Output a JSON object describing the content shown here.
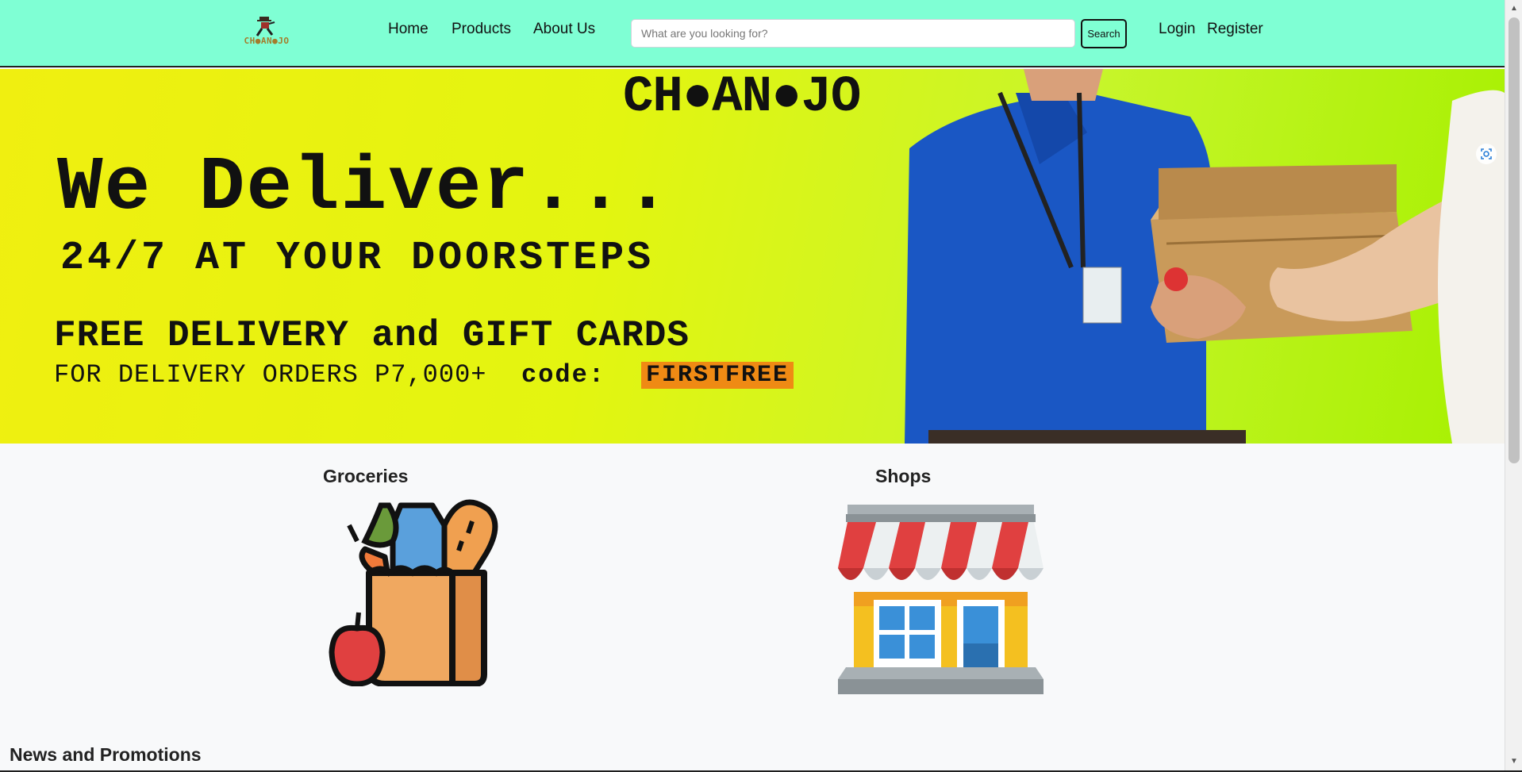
{
  "navbar": {
    "logo_text": "CH●AN●JO",
    "links": {
      "home": "Home",
      "products": "Products",
      "about": "About Us"
    },
    "search": {
      "placeholder": "What are you looking for?",
      "button_label": "Search"
    },
    "auth": {
      "login": "Login",
      "register": "Register"
    },
    "background_color": "#7fffd4"
  },
  "hero": {
    "brand": "CH●AN●JO",
    "headline": "We Deliver...",
    "subheadline": "24/7 AT YOUR DOORSTEPS",
    "offer": "FREE DELIVERY and GIFT CARDS",
    "condition": "FOR DELIVERY ORDERS P7,000+",
    "code_label": "code:",
    "promo_code": "FIRSTFREE",
    "promo_highlight_color": "#ef8a14"
  },
  "categories": [
    {
      "title": "Groceries",
      "icon": "grocery-bag-icon"
    },
    {
      "title": "Shops",
      "icon": "storefront-icon"
    }
  ],
  "sections": {
    "news_title": "News and Promotions"
  }
}
